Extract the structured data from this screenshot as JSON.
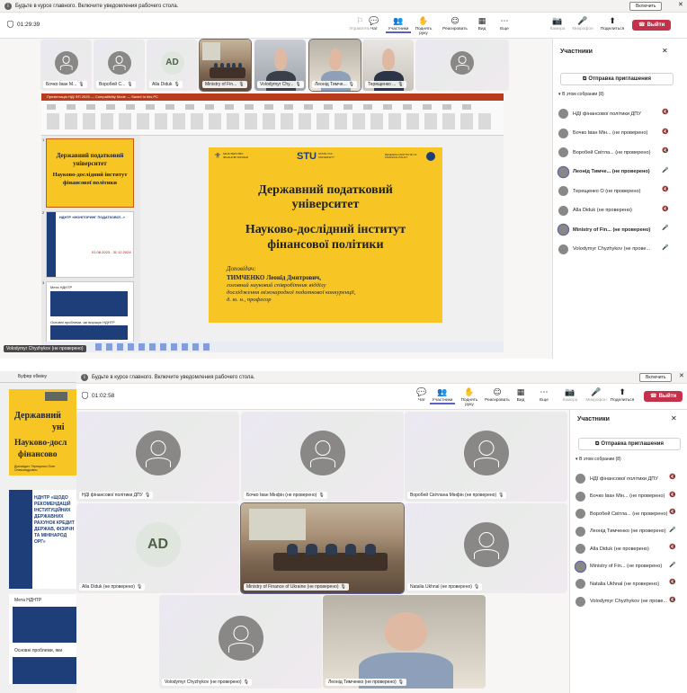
{
  "colors": {
    "accent": "#6264a7",
    "leave": "#c4314b",
    "slide_yellow": "#f7c624",
    "ppt_red": "#b83b1b"
  },
  "screen1": {
    "banner": {
      "text": "Будьте в курсе главного. Включите уведомления рабочего стола.",
      "button": "Включить",
      "close": "✕",
      "info_icon": "i"
    },
    "timer": "01:29:39",
    "toolbar": [
      {
        "icon": "⚐",
        "label": "Управлять",
        "disabled": true
      },
      {
        "icon": "💬",
        "label": "Чат"
      },
      {
        "icon": "👥",
        "label": "Участники",
        "active": true
      },
      {
        "icon": "✋",
        "label": "Поднять руку"
      },
      {
        "icon": "☺",
        "label": "Реагировать"
      },
      {
        "icon": "▦",
        "label": "Вид"
      },
      {
        "icon": "⋯",
        "label": "Еще"
      },
      {
        "icon": "📷",
        "label": "Камера",
        "disabled": true
      },
      {
        "icon": "🎤",
        "label": "Микрофон",
        "disabled": true
      },
      {
        "icon": "⬆",
        "label": "Поделиться"
      }
    ],
    "leave": "Выйти",
    "tiles": [
      {
        "name": "Бочко Іван М...",
        "type": "avatar"
      },
      {
        "name": "Воробей С...",
        "type": "avatar"
      },
      {
        "name": "Alla Diduk",
        "type": "initials",
        "initials": "AD"
      },
      {
        "name": "Ministry of Fin...",
        "type": "room",
        "active": true
      },
      {
        "name": "Volodymyr Chy...",
        "type": "face"
      },
      {
        "name": "Леонід Тимче...",
        "type": "face2",
        "active": true
      },
      {
        "name": "Терещенко ...",
        "type": "face3"
      },
      {
        "name": "",
        "type": "avatar"
      }
    ],
    "presenter": "Volodymyr Chyzhykov (не проверено)",
    "ppt": {
      "titlebar": "Презентація НДІ ФП 2025 — Compatibility Mode — Saved to this PC",
      "slide": {
        "logo_left": "МІНІСТЕРСТВО ФІНАНСІВ УКРАЇНИ",
        "logo_mid": "STU",
        "logo_mid_sub": "STATE TAX UNIVERSITY",
        "logo_right": "RESEARCH INSTITUTE OF FINANCIAL POLICY",
        "title1": "Державний податковий",
        "title2": "університет",
        "title3": "Науково-дослідний інститут",
        "title4": "фінансової політики",
        "speaker_label": "Доповідач:",
        "speaker": "ТИМЧЕНКО Леонід Дмитрович,",
        "pos1": "головний науковий співробітник відділу",
        "pos2": "дослідження міжнародної податкової конкуренції,",
        "pos3": "д. ю. н., професор"
      },
      "thumbs": [
        {
          "num": "1",
          "t1": "Державний податковий",
          "t2": "університет",
          "t3": "Науково-дослідний інститут",
          "t4": "фінансової політики"
        },
        {
          "num": "2",
          "t1": "НДНТР «МОНІТОРИНГ ПОДАТКОВОЇ...»",
          "t2": "01.08.2023 - 31.12.2024"
        },
        {
          "num": "3",
          "t1": "Мета НДНТР",
          "t2": "Основні проблеми, які вирішує НДНТР"
        }
      ]
    },
    "panel": {
      "title": "Участники",
      "invite": "Отправка приглашения",
      "section": "В этом собрании (8)",
      "people": [
        {
          "name": "НДІ фінансової політики ДПУ",
          "mic": "muted"
        },
        {
          "name": "Бочко Іван Мін... (не проверено)",
          "mic": "muted"
        },
        {
          "name": "Воробей Світла... (не проверено)",
          "mic": "muted"
        },
        {
          "name": "Леонід Тимче... (не проверено)",
          "mic": "on",
          "bold": true,
          "ring": true
        },
        {
          "name": "Терещенко О (не проверено)",
          "mic": "muted"
        },
        {
          "name": "Alla Diduk (не проверено)",
          "mic": "muted"
        },
        {
          "name": "Ministry of Fin... (не проверено)",
          "mic": "on",
          "bold": true,
          "ring": true
        },
        {
          "name": "Volodymyr Chyzhykov (не прове...",
          "mic": "on"
        }
      ]
    }
  },
  "screen2": {
    "side_label": "Буфер обміну",
    "banner": {
      "text": "Будьте в курсе главного. Включите уведомления рабочего стола.",
      "button": "Включить",
      "close": "✕",
      "info_icon": "i"
    },
    "timer": "01:02:58",
    "toolbar": [
      {
        "icon": "💬",
        "label": "Чат"
      },
      {
        "icon": "👥",
        "label": "Участники",
        "active": true
      },
      {
        "icon": "✋",
        "label": "Поднять руку"
      },
      {
        "icon": "☺",
        "label": "Реагировать"
      },
      {
        "icon": "▦",
        "label": "Вид"
      },
      {
        "icon": "⋯",
        "label": "Еще"
      },
      {
        "icon": "📷",
        "label": "Камера",
        "disabled": true
      },
      {
        "icon": "🎤",
        "label": "Микрофон",
        "disabled": true
      },
      {
        "icon": "⬆",
        "label": "Поделиться"
      }
    ],
    "leave": "Выйти",
    "tiles": [
      {
        "name": "НДІ фінансової політики ДПУ",
        "type": "avatar"
      },
      {
        "name": "Бочко Іван Мінфін (не проверено)",
        "type": "avatar"
      },
      {
        "name": "Воробей Світлана Мінфін (не проверено)",
        "type": "avatar"
      },
      {
        "name": "Alla Diduk (не проверено)",
        "type": "initials",
        "initials": "AD"
      },
      {
        "name": "Ministry of Finance of Ukraine (не проверено)",
        "type": "room",
        "active": true
      },
      {
        "name": "Natalia Ukhnal (не проверено)",
        "type": "avatar"
      },
      {
        "name": "Volodymyr Chyzhykov (не проверено)",
        "type": "avatar"
      },
      {
        "name": "Леонід Тимченко (не проверено)",
        "type": "face2"
      }
    ],
    "side_slides": {
      "s1_line1": "Державний",
      "s1_line2": "уні",
      "s1_line3": "Науково-досл",
      "s1_line4": "фінансово",
      "s1_speaker": "Доповідач: Терещенко Олег Олександрович",
      "s2_text": "НДНТР «ЩОДО РЕКОМЕНДАЦІЙ ІНСТИТУЦІЙНИХ ДЕРЖАВНИХ РАХУНОК КРЕДИТ ДЕРЖАВ, ФІЗИЧН ТА МІНІНАРОД ОРГ»",
      "s3_title": "Мета НДНТР",
      "s3_sub": "Основні проблеми, яки"
    },
    "panel": {
      "title": "Участники",
      "invite": "Отправка приглашения",
      "section": "В этом собрании (8)",
      "people": [
        {
          "name": "НДІ фінансової політики ДПУ",
          "mic": "muted"
        },
        {
          "name": "Бочко Іван Мін... (не проверено)",
          "mic": "muted"
        },
        {
          "name": "Воробей Світла... (не проверено)",
          "mic": "muted"
        },
        {
          "name": "Леонід Тимченко (не проверено)",
          "mic": "on"
        },
        {
          "name": "Alla Diduk (не проверено)",
          "mic": "muted"
        },
        {
          "name": "Ministry of Fin... (не проверено)",
          "mic": "on",
          "ring": true
        },
        {
          "name": "Natalia Ukhnal (не проверено)",
          "mic": "muted"
        },
        {
          "name": "Volodymyr Chyzhykov (не прове...",
          "mic": "muted"
        }
      ]
    }
  }
}
